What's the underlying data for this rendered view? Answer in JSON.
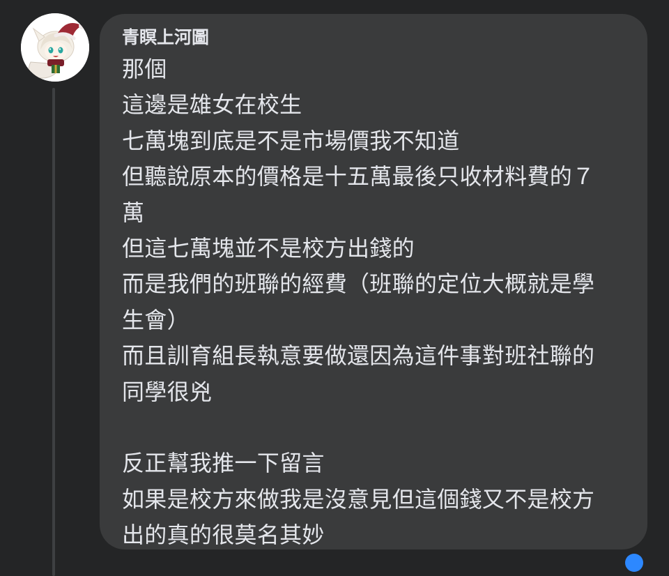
{
  "comment": {
    "author": "青瞑上河圖",
    "lines": [
      "那個",
      "這邊是雄女在校生",
      "七萬塊到底是不是市場價我不知道",
      "但聽說原本的價格是十五萬最後只收材料費的７",
      "萬",
      "但這七萬塊並不是校方出錢的",
      "而是我們的班聯的經費（班聯的定位大概就是學",
      "生會）",
      "而且訓育組長執意要做還因為這件事對班社聯的",
      "同學很兇",
      "",
      "反正幫我推一下留言",
      "如果是校方來做我是沒意見但這個錢又不是校方",
      "出的真的很莫名其妙"
    ]
  },
  "colors": {
    "background": "#242526",
    "bubble": "#3a3b3c",
    "text": "#e4e6eb",
    "thread_line": "#3e4042"
  }
}
